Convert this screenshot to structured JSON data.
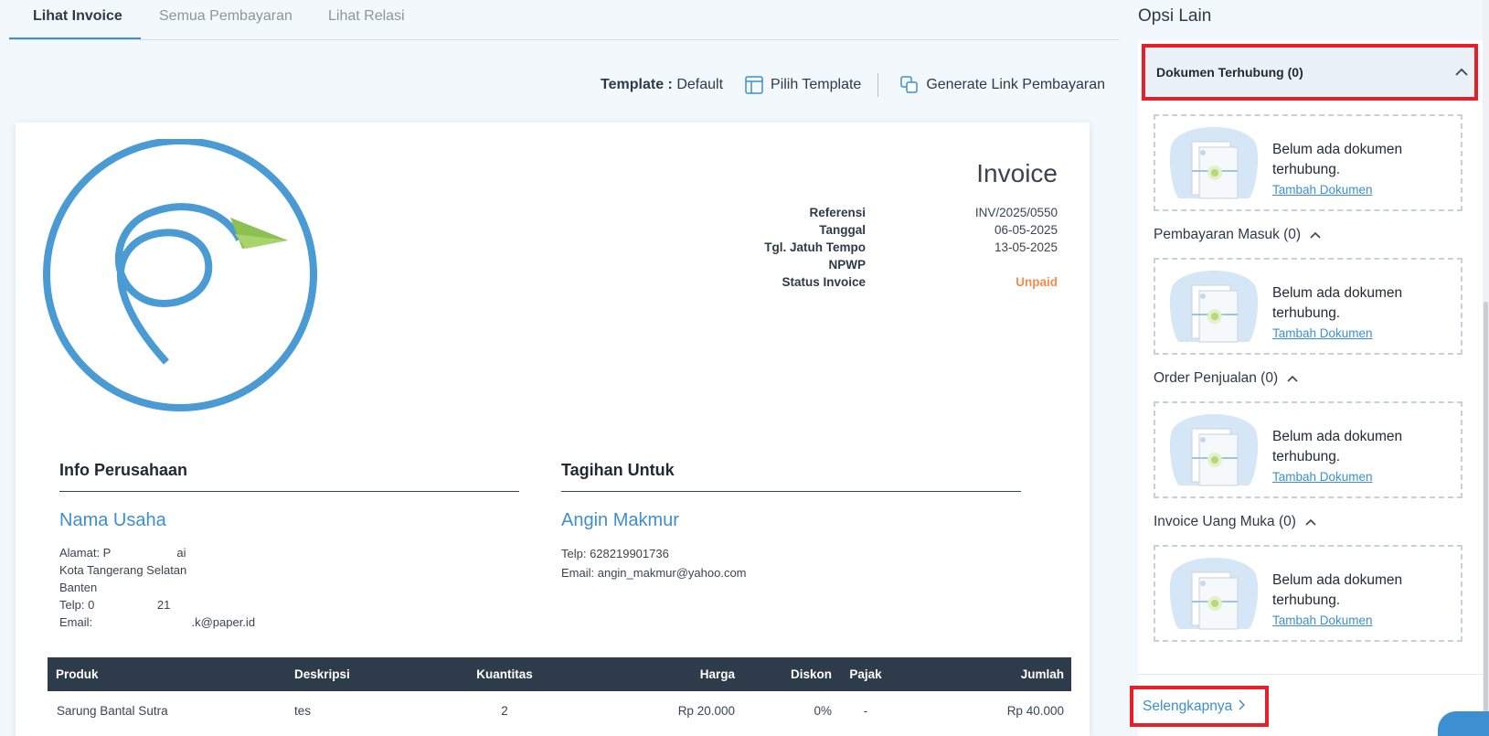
{
  "tabs": [
    {
      "label": "Lihat Invoice",
      "active": true
    },
    {
      "label": "Semua Pembayaran",
      "active": false
    },
    {
      "label": "Lihat Relasi",
      "active": false
    }
  ],
  "toolbar": {
    "template_label": "Template :",
    "template_value": "Default",
    "choose_template": "Pilih Template",
    "generate_link": "Generate Link Pembayaran"
  },
  "invoice": {
    "title": "Invoice",
    "meta": [
      {
        "key": "Referensi",
        "value": "INV/2025/0550"
      },
      {
        "key": "Tanggal",
        "value": "06-05-2025"
      },
      {
        "key": "Tgl. Jatuh Tempo",
        "value": "13-05-2025"
      },
      {
        "key": "NPWP",
        "value": ""
      },
      {
        "key": "Status Invoice",
        "value": "Unpaid"
      }
    ],
    "company": {
      "heading": "Info Perusahaan",
      "name": "Nama Usaha",
      "lines": [
        "Alamat: P                    ai",
        "Kota Tangerang Selatan",
        "Banten",
        "Telp: 0                   21",
        "Email:                              .k@paper.id"
      ]
    },
    "bill_to": {
      "heading": "Tagihan Untuk",
      "name": "Angin Makmur",
      "lines": [
        "Telp: 628219901736",
        "Email: angin_makmur@yahoo.com"
      ]
    },
    "table": {
      "headers": [
        "Produk",
        "Deskripsi",
        "Kuantitas",
        "Harga",
        "Diskon",
        "Pajak",
        "Jumlah"
      ],
      "rows": [
        [
          "Sarung Bantal Sutra",
          "tes",
          "2",
          "Rp 20.000",
          "0%",
          "-",
          "Rp 40.000"
        ]
      ]
    }
  },
  "side": {
    "title": "Opsi Lain",
    "sections": [
      {
        "label": "Dokumen Terhubung (0)"
      },
      {
        "label": "Pembayaran Masuk (0)"
      },
      {
        "label": "Order Penjualan (0)"
      },
      {
        "label": "Invoice Uang Muka (0)"
      }
    ],
    "empty_line1": "Belum ada dokumen",
    "empty_line2": "terhubung.",
    "add_doc": "Tambah Dokumen",
    "more": "Selengkapnya"
  },
  "colors": {
    "accent": "#3c8fd0",
    "unpaid": "#f28c4a",
    "header_dark": "#2e3b4a",
    "highlight": "#e5202a"
  }
}
